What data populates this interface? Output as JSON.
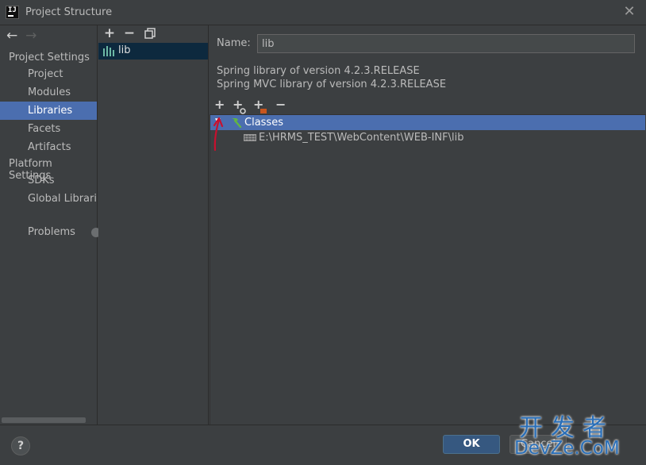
{
  "window": {
    "title": "Project Structure",
    "close_symbol": "✕"
  },
  "nav": {
    "back_symbol": "←",
    "forward_symbol": "→",
    "project_settings_header": "Project Settings",
    "project_settings_items": [
      "Project",
      "Modules",
      "Libraries",
      "Facets",
      "Artifacts"
    ],
    "platform_settings_header": "Platform Settings",
    "platform_settings_items": [
      "SDKs",
      "Global Libraries"
    ],
    "problems_label": "Problems",
    "selected_item": "Libraries"
  },
  "libraries_list": {
    "toolbar": {
      "add": "+",
      "remove": "−"
    },
    "items": [
      "lib"
    ]
  },
  "library_detail": {
    "name_label": "Name:",
    "name_value": "lib",
    "description_lines": [
      "Spring library of version 4.2.3.RELEASE",
      "Spring MVC library of version 4.2.3.RELEASE"
    ],
    "toolbar": {
      "add": "+",
      "add_alt": "+",
      "add_other": "+",
      "remove": "−"
    },
    "tree": {
      "root_label": "Classes",
      "children": [
        "E:\\HRMS_TEST\\WebContent\\WEB-INF\\lib"
      ]
    }
  },
  "footer": {
    "help_symbol": "?",
    "ok_label": "OK",
    "cancel_label": "Cancel"
  },
  "watermark": {
    "line1": "开发者",
    "line2": "DevZe.CoM"
  },
  "colors": {
    "background": "#3c3f41",
    "selection": "#4b6eaf",
    "ok_button": "#365880",
    "annotation_arrow": "#c8102e",
    "watermark": "#2a6fb8"
  }
}
